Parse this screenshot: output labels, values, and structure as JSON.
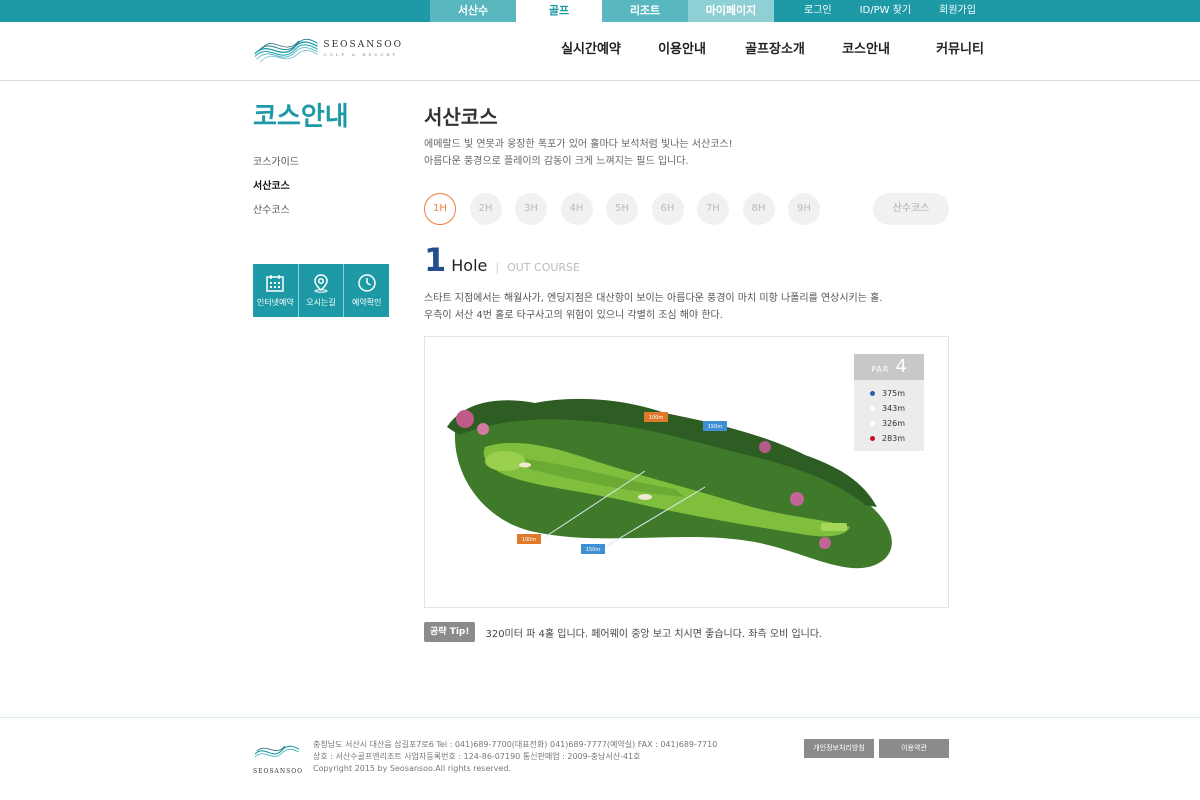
{
  "topbar": {
    "site_tabs": [
      "서산수",
      "골프",
      "리조트",
      "마이페이지"
    ],
    "util_links": [
      "로그인",
      "ID/PW 찾기",
      "회원가입"
    ]
  },
  "header": {
    "logo_text": "SEOSANSOO",
    "logo_sub": "GOLF & RESORT",
    "nav": [
      "실시간예약",
      "이용안내",
      "골프장소개",
      "코스안내",
      "커뮤니티"
    ]
  },
  "sidebar": {
    "title": "코스안내",
    "items": [
      "코스가이드",
      "서산코스",
      "산수코스"
    ],
    "quick": [
      "인터넷예약",
      "오시는길",
      "예약확인"
    ]
  },
  "main": {
    "title": "서산코스",
    "desc_lines": [
      "에메랄드 빛 연못과 웅장한 폭포가 있어 홀마다 보석처럼 빛나는 서산코스!",
      "아름다운 풍경으로 플레이의 감동이 크게 느껴지는 필드 입니다."
    ],
    "holes": [
      "1H",
      "2H",
      "3H",
      "4H",
      "5H",
      "6H",
      "7H",
      "8H",
      "9H"
    ],
    "course_button": "산수코스",
    "hole_number": "1",
    "hole_word": "Hole",
    "hole_course": "OUT COURSE",
    "hole_desc_lines": [
      "스타트 지점에서는 해월사가, 엔딩지점은 대산항이 보이는 아름다운 풍경이 마치 미항 나폴리를 연상시키는 홀.",
      "우측이 서산 4번 홀로 타구사고의 위험이 있으니 각별히 조심 해야 한다."
    ],
    "par_label": "PAR",
    "par_value": "4",
    "distances": [
      {
        "text": "375m",
        "color": "#2a5fb0"
      },
      {
        "text": "343m",
        "color": "#ffffff"
      },
      {
        "text": "326m",
        "color": "#ffffff"
      },
      {
        "text": "283m",
        "color": "#c0151d"
      }
    ],
    "map_markers": [
      "100m",
      "150m",
      "100m",
      "150m"
    ],
    "tip_badge": "공략 Tip!",
    "tip_text": "320미터 파 4홀 입니다. 페어웨이 중앙 보고 치시면 좋습니다. 좌측 오비 입니다."
  },
  "footer": {
    "logo_text": "SEOSANSOO",
    "address_lines": [
      "충청남도 서산시 대산읍 삼길포7로6 Tel : 041)689-7700(대표전화) 041)689-7777(예약실) FAX : 041)689-7710",
      "상호 : 서산수골프앤리조트 사업자등록번호 : 124-86-07190 통신판매업 : 2009-충남서산-41호",
      "Copyright 2015 by Seosansoo.All rights reserved."
    ],
    "buttons": [
      "개인정보처리방침",
      "이용약관"
    ]
  }
}
